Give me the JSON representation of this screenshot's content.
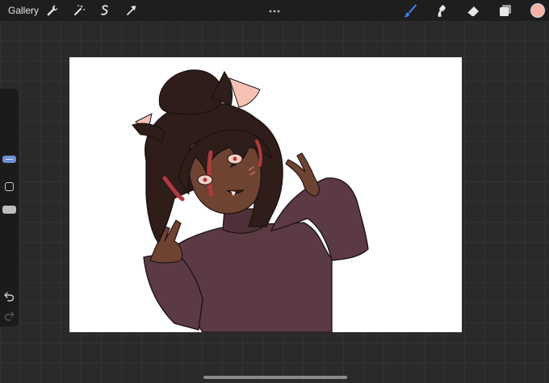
{
  "topbar": {
    "gallery_label": "Gallery",
    "left_tools": [
      "wrench-icon",
      "magic-wand-icon",
      "selection-icon",
      "transform-arrow-icon"
    ],
    "right_tools": [
      "brush-icon",
      "smudge-icon",
      "eraser-icon",
      "layers-icon"
    ],
    "active_tool": "brush-icon",
    "current_color": "#f4b3a4",
    "accent_color": "#3f7bf2"
  },
  "sidebar": {
    "controls": [
      "brush-size-slider",
      "modify-button",
      "opacity-slider",
      "undo-icon",
      "redo-icon"
    ],
    "size_slider_color": "#6d8fd6",
    "opacity_slider_color": "#bdbdbd"
  },
  "canvas": {
    "background": "#ffffff",
    "artwork": "illustration",
    "palette": {
      "hair": "#2e1d18",
      "skin": "#6e4331",
      "sweater": "#5b3a44",
      "ear_inner": "#f6c2b6",
      "hair_streak": "#b2393b",
      "line": "#1a1010"
    }
  }
}
